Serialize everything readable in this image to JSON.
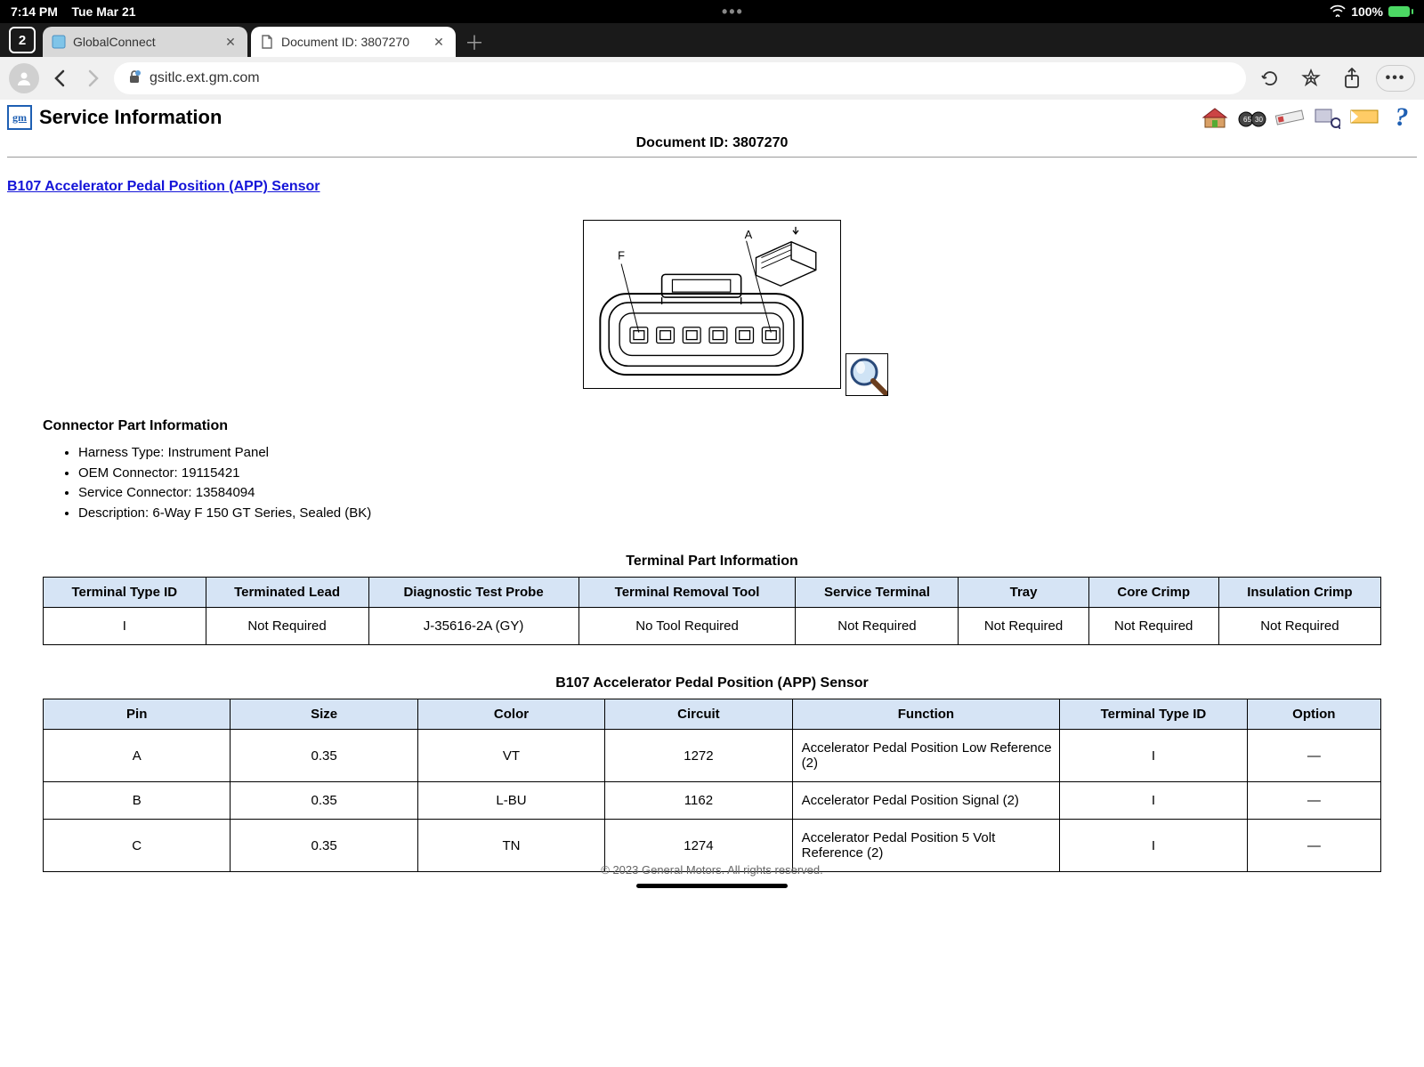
{
  "statusbar": {
    "time": "7:14 PM",
    "date": "Tue Mar 21",
    "battery": "100%"
  },
  "browser": {
    "tab_count": "2",
    "tabs": [
      {
        "label": "GlobalConnect"
      },
      {
        "label": "Document ID: 3807270"
      }
    ],
    "url": "gsitlc.ext.gm.com"
  },
  "page": {
    "service_title": "Service Information",
    "document_id_label": "Document ID: 3807270",
    "section_link": "B107 Accelerator Pedal Position (APP) Sensor",
    "connector_heading": "Connector Part Information",
    "connector_bullets": [
      "Harness Type: Instrument Panel",
      "OEM Connector: 19115421",
      "Service Connector: 13584094",
      "Description: 6-Way F 150 GT Series, Sealed (BK)"
    ],
    "terminal_table": {
      "caption": "Terminal Part Information",
      "headers": [
        "Terminal Type ID",
        "Terminated Lead",
        "Diagnostic Test Probe",
        "Terminal Removal Tool",
        "Service Terminal",
        "Tray",
        "Core Crimp",
        "Insulation Crimp"
      ],
      "rows": [
        [
          "I",
          "Not Required",
          "J-35616-2A (GY)",
          "No Tool Required",
          "Not Required",
          "Not Required",
          "Not Required",
          "Not Required"
        ]
      ]
    },
    "pin_table": {
      "caption": "B107 Accelerator Pedal Position (APP) Sensor",
      "headers": [
        "Pin",
        "Size",
        "Color",
        "Circuit",
        "Function",
        "Terminal Type ID",
        "Option"
      ],
      "rows": [
        {
          "pin": "A",
          "size": "0.35",
          "color": "VT",
          "circuit": "1272",
          "function": "Accelerator Pedal Position Low Reference (2)",
          "ttid": "I",
          "option": "—"
        },
        {
          "pin": "B",
          "size": "0.35",
          "color": "L-BU",
          "circuit": "1162",
          "function": "Accelerator Pedal Position Signal (2)",
          "ttid": "I",
          "option": "—"
        },
        {
          "pin": "C",
          "size": "0.35",
          "color": "TN",
          "circuit": "1274",
          "function": "Accelerator Pedal Position 5 Volt Reference (2)",
          "ttid": "I",
          "option": "—"
        }
      ]
    },
    "footer": "© 2023 General Motors. All rights reserved."
  },
  "diagram": {
    "label_a": "A",
    "label_f": "F"
  }
}
